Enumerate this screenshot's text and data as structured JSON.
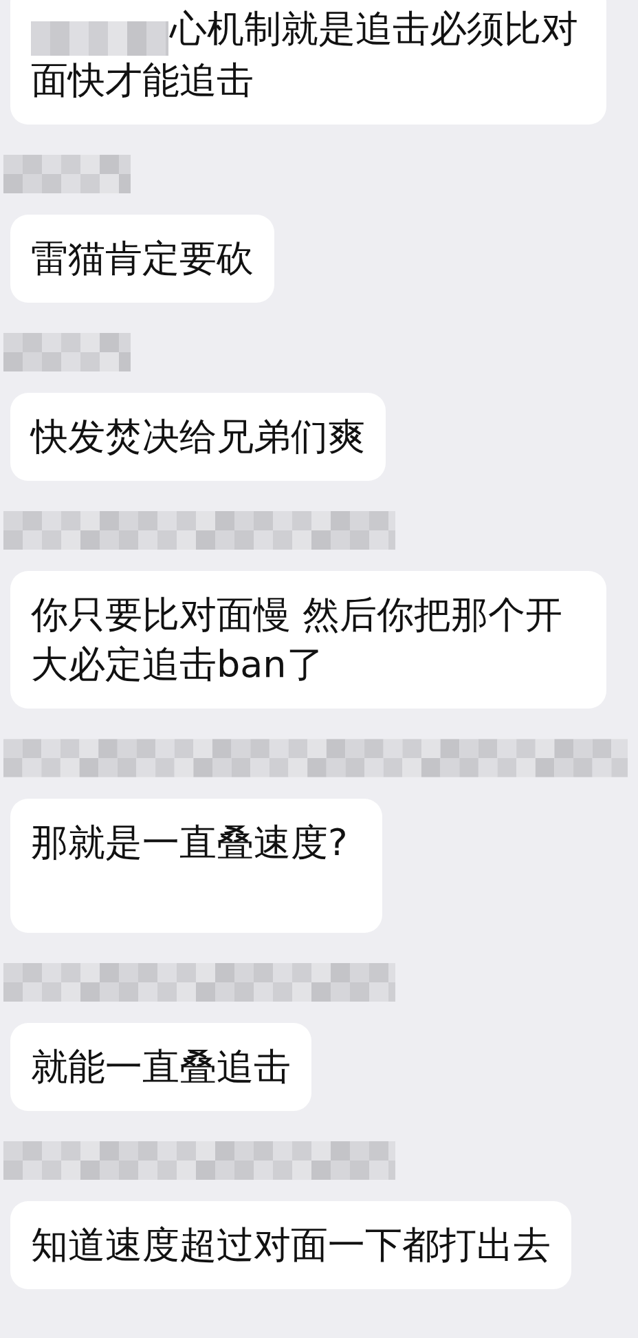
{
  "messages": [
    {
      "text": "心机制就是追击必须比对面快才能追击",
      "sender_hidden": true
    },
    {
      "text": "雷猫肯定要砍",
      "sender_hidden": true
    },
    {
      "text": "快发焚决给兄弟们爽",
      "sender_hidden": true
    },
    {
      "text": "你只要比对面慢 然后你把那个开大必定追击ban了",
      "sender_hidden": true
    },
    {
      "text": "那就是一直叠速度?",
      "sender_hidden": true
    },
    {
      "text": "就能一直叠追击",
      "sender_hidden": true
    },
    {
      "text": "知道速度超过对面一下都打出去",
      "sender_hidden": true
    }
  ]
}
